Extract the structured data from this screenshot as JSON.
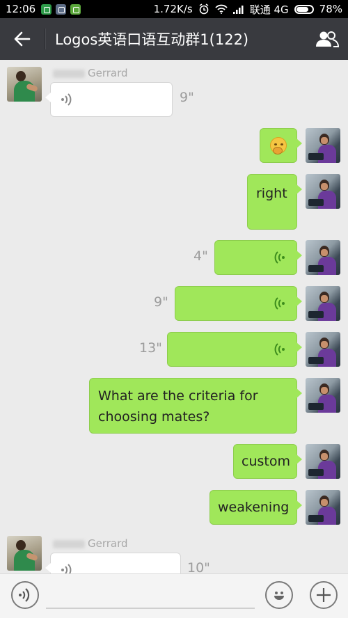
{
  "status_bar": {
    "time": "12:06",
    "speed": "1.72K/s",
    "carrier": "联通 4G",
    "battery": "78%",
    "battery_level": 0.78
  },
  "header": {
    "title": "Logos英语口语互动群1(122)",
    "back_icon": "arrow-left-icon",
    "members_icon": "group-members-icon"
  },
  "messages": [
    {
      "from": "other",
      "sender": "Gerrard",
      "type": "voice",
      "duration": "9\""
    },
    {
      "from": "me",
      "type": "emoji",
      "emoji": "thinking-face"
    },
    {
      "from": "me",
      "type": "text",
      "text": "right"
    },
    {
      "from": "me",
      "type": "voice",
      "duration": "4\""
    },
    {
      "from": "me",
      "type": "voice",
      "duration": "9\""
    },
    {
      "from": "me",
      "type": "voice",
      "duration": "13\""
    },
    {
      "from": "me",
      "type": "text",
      "lines": [
        "What are the criteria for",
        "choosing mates?"
      ]
    },
    {
      "from": "me",
      "type": "text",
      "text": "custom"
    },
    {
      "from": "me",
      "type": "text",
      "text": "weakening"
    },
    {
      "from": "other",
      "sender": "Gerrard",
      "type": "voice",
      "duration": "10\""
    }
  ],
  "input_bar": {
    "voice_icon": "voice-input-icon",
    "emoji_icon": "smiley-icon",
    "plus_icon": "plus-icon"
  },
  "colors": {
    "status_bg": "#000000",
    "header_bg": "#393a3f",
    "chat_bg": "#ebebeb",
    "my_bubble": "#a0e75a",
    "other_bubble": "#ffffff",
    "voice_wave_green": "#3c8c1c"
  }
}
